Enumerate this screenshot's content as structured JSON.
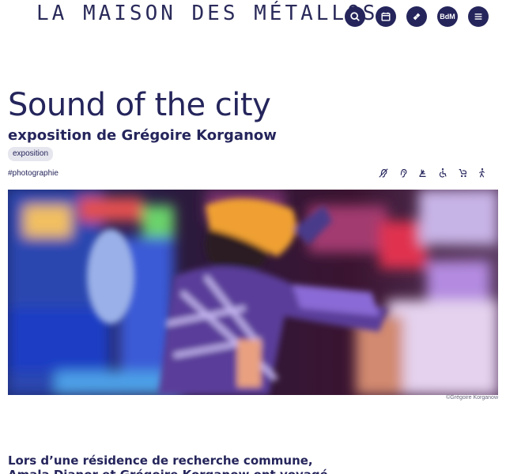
{
  "header": {
    "logo": "LA MAISON DES MÉTALLOS",
    "icons": [
      {
        "name": "search-icon",
        "label": ""
      },
      {
        "name": "calendar-icon",
        "label": ""
      },
      {
        "name": "ticket-icon",
        "label": ""
      },
      {
        "name": "bdm-icon",
        "label": "BdM"
      },
      {
        "name": "menu-icon",
        "label": ""
      }
    ],
    "accent": "#25255c"
  },
  "event": {
    "title": "Sound of the city",
    "subtitle": "exposition de Grégoire Korganow",
    "tag": "exposition",
    "hashtag": "#photographie"
  },
  "accessibility_icons": [
    "deaf-icon",
    "hearing-loop-icon",
    "sign-language-icon",
    "wheelchair-icon",
    "stroller-icon",
    "walking-icon"
  ],
  "hero": {
    "credit": "©Grégoire Korganow"
  },
  "intro": {
    "line1": "Lors d’une résidence de recherche commune,",
    "line2": "Amala Dianor et Grégoire Korganow ont voyagé"
  }
}
